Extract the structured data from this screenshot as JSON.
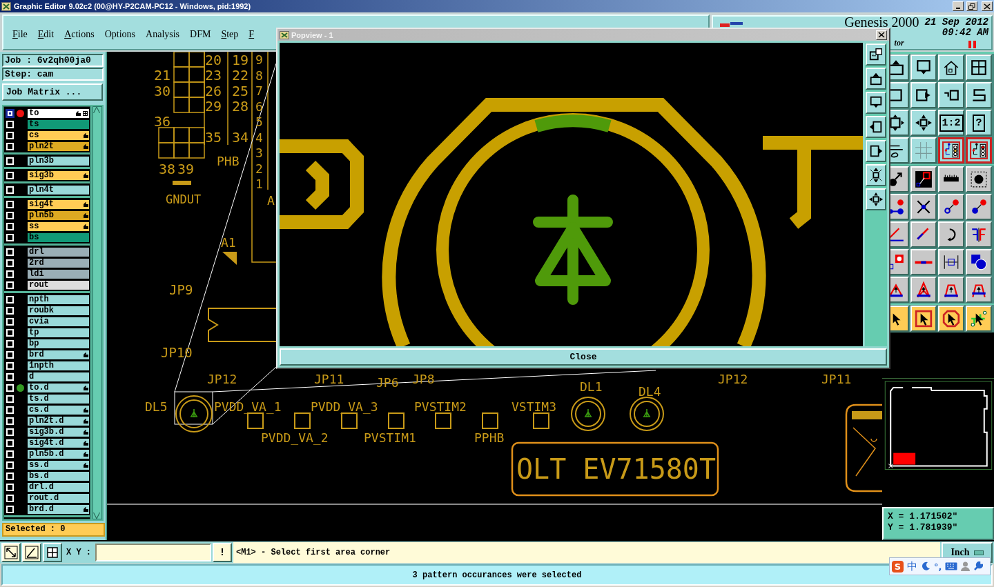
{
  "window": {
    "title": "Graphic Editor 9.02c2 (00@HY-P2CAM-PC12 - Windows, pid:1992)"
  },
  "menu": [
    {
      "label": "File",
      "mnemonic": true
    },
    {
      "label": "Edit",
      "mnemonic": true
    },
    {
      "label": "Actions",
      "mnemonic": true
    },
    {
      "label": "Options",
      "mnemonic": false
    },
    {
      "label": "Analysis",
      "mnemonic": false
    },
    {
      "label": "DFM",
      "mnemonic": false
    },
    {
      "label": "Step",
      "mnemonic": true
    },
    {
      "label": "F",
      "mnemonic": true
    }
  ],
  "header": {
    "product": "Genesis 2000",
    "subtitle": "tor",
    "date": "21 Sep 2012",
    "time": "09:42 AM",
    "paused": true
  },
  "job": {
    "job": "Job : 6v2qh00ja0",
    "step": "Step: cam",
    "matrix_button": "Job Matrix ..."
  },
  "layer_groups": [
    {
      "layers": [
        {
          "name": "to",
          "color": "#ffffff",
          "selected": true,
          "work": true,
          "displayed": false,
          "affected": true
        },
        {
          "name": "ts",
          "color": "#119977",
          "selected": false,
          "work": false,
          "displayed": false,
          "affected": false
        },
        {
          "name": "cs",
          "color": "#ffcc55",
          "selected": false,
          "work": false,
          "displayed": false,
          "affected": true
        },
        {
          "name": "pln2t",
          "color": "#ddaa22",
          "selected": false,
          "work": false,
          "displayed": false,
          "affected": true
        }
      ]
    },
    {
      "layers": [
        {
          "name": "pln3b",
          "color": "#99d9d9",
          "selected": false,
          "work": false,
          "displayed": false,
          "affected": false
        }
      ]
    },
    {
      "layers": [
        {
          "name": "sig3b",
          "color": "#ffcc55",
          "selected": false,
          "work": false,
          "displayed": false,
          "affected": true
        }
      ]
    },
    {
      "layers": [
        {
          "name": "pln4t",
          "color": "#99d9d9",
          "selected": false,
          "work": false,
          "displayed": false,
          "affected": false
        }
      ]
    },
    {
      "layers": [
        {
          "name": "sig4t",
          "color": "#ffcc55",
          "selected": false,
          "work": false,
          "displayed": false,
          "affected": true
        },
        {
          "name": "pln5b",
          "color": "#ddaa22",
          "selected": false,
          "work": false,
          "displayed": false,
          "affected": true
        },
        {
          "name": "ss",
          "color": "#ffcc55",
          "selected": false,
          "work": false,
          "displayed": false,
          "affected": true
        },
        {
          "name": "bs",
          "color": "#119977",
          "selected": false,
          "work": false,
          "displayed": false,
          "affected": false
        }
      ]
    },
    {
      "layers": [
        {
          "name": "drl",
          "color": "#9aaeb6",
          "selected": false,
          "work": false,
          "displayed": false,
          "affected": false
        },
        {
          "name": "2rd",
          "color": "#9aaeb6",
          "selected": false,
          "work": false,
          "displayed": false,
          "affected": false
        },
        {
          "name": "ldi",
          "color": "#9aaeb6",
          "selected": false,
          "work": false,
          "displayed": false,
          "affected": false
        },
        {
          "name": "rout",
          "color": "#dddddd",
          "selected": false,
          "work": false,
          "displayed": false,
          "affected": false
        }
      ]
    },
    {
      "layers": [
        {
          "name": "npth",
          "color": "#99d9d9",
          "selected": false,
          "work": false,
          "displayed": false,
          "affected": false
        },
        {
          "name": "roubk",
          "color": "#99d9d9",
          "selected": false,
          "work": false,
          "displayed": false,
          "affected": false
        },
        {
          "name": "cvia",
          "color": "#99d9d9",
          "selected": false,
          "work": false,
          "displayed": false,
          "affected": false
        },
        {
          "name": "tp",
          "color": "#99d9d9",
          "selected": false,
          "work": false,
          "displayed": false,
          "affected": false
        },
        {
          "name": "bp",
          "color": "#99d9d9",
          "selected": false,
          "work": false,
          "displayed": false,
          "affected": false
        },
        {
          "name": "brd",
          "color": "#99d9d9",
          "selected": false,
          "work": false,
          "displayed": false,
          "affected": true
        },
        {
          "name": "1npth",
          "color": "#99d9d9",
          "selected": false,
          "work": false,
          "displayed": false,
          "affected": false
        },
        {
          "name": "d",
          "color": "#99d9d9",
          "selected": false,
          "work": false,
          "displayed": false,
          "affected": false
        },
        {
          "name": "to.d",
          "color": "#99d9d9",
          "selected": false,
          "work": false,
          "displayed": true,
          "affected": true
        },
        {
          "name": "ts.d",
          "color": "#99d9d9",
          "selected": false,
          "work": false,
          "displayed": false,
          "affected": false
        },
        {
          "name": "cs.d",
          "color": "#99d9d9",
          "selected": false,
          "work": false,
          "displayed": false,
          "affected": true
        },
        {
          "name": "pln2t.d",
          "color": "#99d9d9",
          "selected": false,
          "work": false,
          "displayed": false,
          "affected": true
        },
        {
          "name": "sig3b.d",
          "color": "#99d9d9",
          "selected": false,
          "work": false,
          "displayed": false,
          "affected": true
        },
        {
          "name": "sig4t.d",
          "color": "#99d9d9",
          "selected": false,
          "work": false,
          "displayed": false,
          "affected": true
        },
        {
          "name": "pln5b.d",
          "color": "#99d9d9",
          "selected": false,
          "work": false,
          "displayed": false,
          "affected": true
        },
        {
          "name": "ss.d",
          "color": "#99d9d9",
          "selected": false,
          "work": false,
          "displayed": false,
          "affected": true
        },
        {
          "name": "bs.d",
          "color": "#99d9d9",
          "selected": false,
          "work": false,
          "displayed": false,
          "affected": false
        },
        {
          "name": "drl.d",
          "color": "#99d9d9",
          "selected": false,
          "work": false,
          "displayed": false,
          "affected": false
        },
        {
          "name": "rout.d",
          "color": "#99d9d9",
          "selected": false,
          "work": false,
          "displayed": false,
          "affected": false
        },
        {
          "name": "brd.d",
          "color": "#99d9d9",
          "selected": false,
          "work": false,
          "displayed": false,
          "affected": true
        }
      ]
    }
  ],
  "selected_count": "Selected : 0",
  "board": {
    "labels": [
      "20",
      "19",
      "21",
      "23",
      "22",
      "30",
      "26",
      "25",
      "29",
      "28",
      "36",
      "35",
      "34",
      "38",
      "39",
      "PHB",
      "GNDUT",
      "A1",
      "JP9",
      "JP10",
      "JP12",
      "JP11",
      "JP6",
      "JP8",
      "DL5",
      "PVDD_VA_1",
      "PVDD_VA_3",
      "PVSTIM2",
      "VSTIM3",
      "DL1",
      "DL4",
      "PVDD_VA_2",
      "PVSTIM1",
      "PPHB",
      "OLT EV71580T",
      "JP12",
      "JP11",
      "A"
    ],
    "pin_numbers": [
      "9",
      "8",
      "7",
      "6",
      "5",
      "4",
      "3",
      "2",
      "1"
    ]
  },
  "popview": {
    "title": "Popview - 1",
    "close": "Close"
  },
  "tool_groups": [
    {
      "kind": "view",
      "tools": [
        {
          "selected": false
        },
        {
          "selected": false
        },
        {
          "selected": false
        },
        {
          "selected": false
        },
        {
          "selected": false
        },
        {
          "selected": false
        },
        {
          "selected": false
        },
        {
          "selected": false
        },
        {
          "selected": false
        },
        {
          "selected": false
        },
        {
          "selected": false,
          "label": "1:2"
        },
        {
          "selected": false,
          "label": "?"
        },
        {
          "selected": false
        },
        {
          "selected": false
        },
        {
          "selected": true
        },
        {
          "selected": true
        }
      ]
    },
    {
      "kind": "edit",
      "tools": [
        {
          "selected": false
        },
        {
          "selected": false
        },
        {
          "selected": false
        },
        {
          "selected": false
        },
        {
          "selected": false
        },
        {
          "selected": false
        },
        {
          "selected": false
        },
        {
          "selected": false
        },
        {
          "selected": false
        },
        {
          "selected": false
        },
        {
          "selected": false
        },
        {
          "selected": false
        },
        {
          "selected": false
        },
        {
          "selected": false
        },
        {
          "selected": false
        },
        {
          "selected": false
        },
        {
          "selected": false
        },
        {
          "selected": false
        },
        {
          "selected": false
        },
        {
          "selected": false
        }
      ]
    },
    {
      "kind": "select",
      "tools": [
        {
          "selected": false
        },
        {
          "selected": false
        },
        {
          "selected": false
        },
        {
          "selected": false
        }
      ]
    }
  ],
  "coordinates": {
    "x": "X = 1.171502\"",
    "y": "Y = 1.781939\""
  },
  "command": {
    "prompt": "X Y :",
    "alert": "!",
    "message": "<M1> - Select first area corner",
    "units": "Inch"
  },
  "status": "3 pattern occurances were selected",
  "ime": {
    "logo": "S",
    "mode": "中",
    "punctuation": "°,"
  }
}
